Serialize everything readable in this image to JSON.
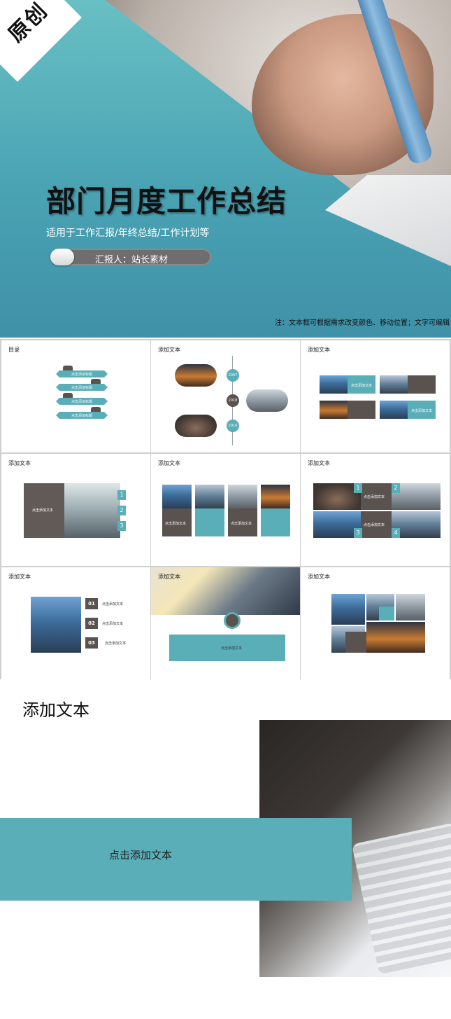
{
  "hero": {
    "badge": "原创",
    "title": "部门月度工作总结",
    "subtitle": "适用于工作汇报/年终总结/工作计划等",
    "reporter": "汇报人：站长素材",
    "note": "注：文本框可根据需求改变颜色、移动位置；文字可编辑"
  },
  "thumbs": {
    "t1": {
      "label": "目录",
      "items": [
        "点击添加标题",
        "点击添加标题",
        "点击添加标题",
        "点击添加标题"
      ]
    },
    "t2": {
      "label": "添加文本",
      "years": [
        "2007",
        "2018",
        "2019"
      ]
    },
    "t3": {
      "label": "添加文本",
      "cells": [
        "点击添加文本",
        "点击添加文本"
      ]
    },
    "t4": {
      "label": "添加文本",
      "text": "点击添加文本",
      "nums": [
        "1",
        "2",
        "3"
      ]
    },
    "t5": {
      "label": "添加文本",
      "cells": [
        "点击添加文本",
        "点击添加文本"
      ]
    },
    "t6": {
      "label": "添加文本",
      "nums": [
        "1",
        "2",
        "3",
        "4"
      ],
      "cells": [
        "点击添加文本",
        "点击添加文本"
      ]
    },
    "t7": {
      "label": "添加文本",
      "steps": [
        "01",
        "02",
        "03"
      ],
      "items": [
        "点击添加文本",
        "点击添加文本",
        "点击添加文本"
      ]
    },
    "t8": {
      "label": "添加文本",
      "text": "点击添加文本"
    },
    "t9": {
      "label": "添加文本"
    }
  },
  "bottom": {
    "title": "添加文本",
    "band_text": "点击添加文本"
  },
  "colors": {
    "teal": "#5aaeb8",
    "dark": "#5a524e",
    "hero_gradient_top": "#68c0c4"
  }
}
